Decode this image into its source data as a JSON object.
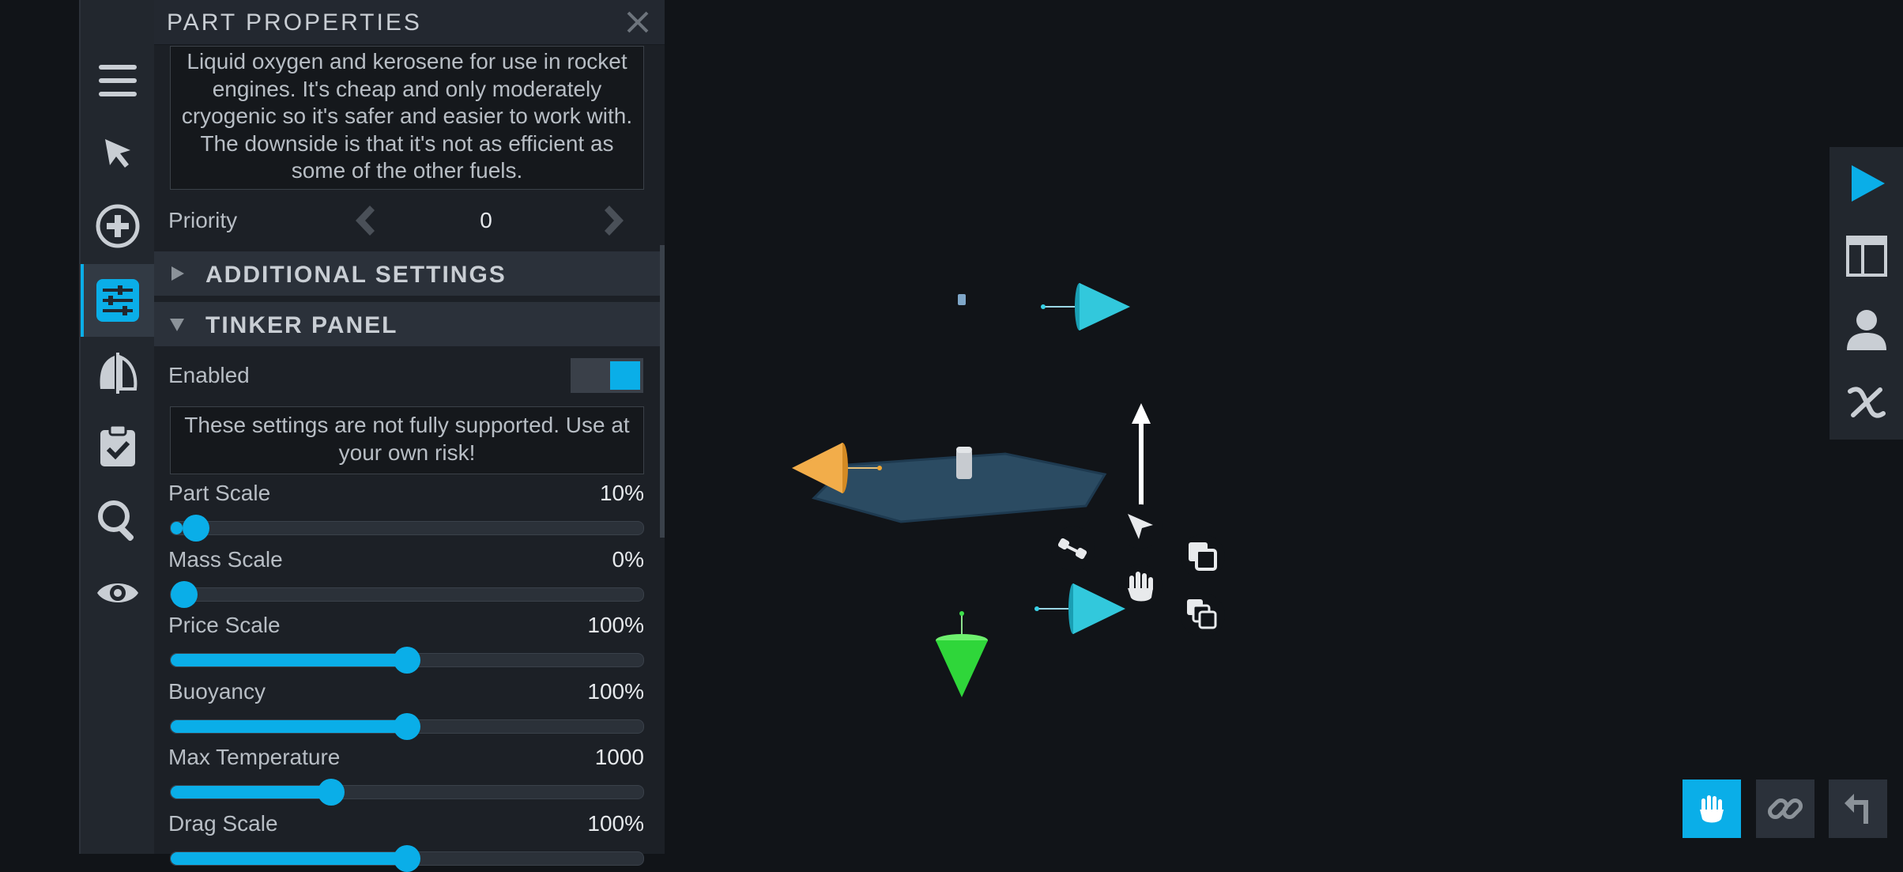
{
  "panel": {
    "title": "PART PROPERTIES",
    "description": "Liquid oxygen and kerosene for use in rocket engines. It's cheap and only moderately cryogenic so it's safer and easier to work with. The downside is that it's not as efficient as some of the other fuels.",
    "priority": {
      "label": "Priority",
      "value": "0"
    },
    "sections": {
      "additional": "ADDITIONAL SETTINGS",
      "tinker": "TINKER PANEL"
    },
    "enabled": {
      "label": "Enabled",
      "on": true
    },
    "warning": "These settings are not fully supported. Use at your own risk!",
    "sliders": [
      {
        "label": "Part Scale",
        "value": "10%",
        "fraction": 0.025
      },
      {
        "label": "Mass Scale",
        "value": "0%",
        "fraction": 0.0
      },
      {
        "label": "Price Scale",
        "value": "100%",
        "fraction": 0.5
      },
      {
        "label": "Buoyancy",
        "value": "100%",
        "fraction": 0.5
      },
      {
        "label": "Max Temperature",
        "value": "1000",
        "fraction": 0.34
      },
      {
        "label": "Drag Scale",
        "value": "100%",
        "fraction": 0.5
      }
    ]
  },
  "toolbar": {
    "items": [
      {
        "icon": "menu-icon"
      },
      {
        "icon": "pointer-icon"
      },
      {
        "icon": "add-part-icon"
      },
      {
        "icon": "part-properties-icon",
        "active": true
      },
      {
        "icon": "symmetry-icon"
      },
      {
        "icon": "checklist-icon"
      },
      {
        "icon": "search-icon"
      },
      {
        "icon": "view-icon"
      }
    ]
  },
  "rightbar": {
    "items": [
      {
        "icon": "play-icon"
      },
      {
        "icon": "layout-icon"
      },
      {
        "icon": "user-icon"
      },
      {
        "icon": "variables-icon"
      }
    ]
  },
  "bottom": {
    "items": [
      {
        "icon": "hand-move-icon",
        "active": true
      },
      {
        "icon": "link-icon"
      },
      {
        "icon": "undo-icon"
      }
    ]
  },
  "colors": {
    "accent": "#0aaee8",
    "panel_bg": "#1c2026",
    "viewport_bg": "#111418"
  }
}
